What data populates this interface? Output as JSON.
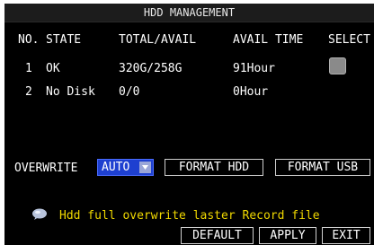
{
  "title": "HDD MANAGEMENT",
  "table": {
    "headers": {
      "no": "NO.",
      "state": "STATE",
      "total_avail": "TOTAL/AVAIL",
      "avail_time": "AVAIL TIME",
      "select": "SELECT"
    },
    "rows": [
      {
        "no": "1",
        "state": "OK",
        "total_avail": "320G/258G",
        "avail_time": "91Hour",
        "selected": false
      },
      {
        "no": "2",
        "state": "No Disk",
        "total_avail": "0/0",
        "avail_time": "0Hour"
      }
    ]
  },
  "overwrite": {
    "label": "OVERWRITE",
    "value": "AUTO"
  },
  "buttons": {
    "format_hdd": "FORMAT HDD",
    "format_usb": "FORMAT USB",
    "default": "DEFAULT",
    "apply": "APPLY",
    "exit": "EXIT"
  },
  "tip": {
    "icon": "speech-bubble-icon",
    "text": "Hdd full overwrite laster Record file"
  },
  "colors": {
    "background": "#000000",
    "title_bar": "#1c1c1c",
    "dropdown": "#1e40d0",
    "tip_text": "#f0d800",
    "checkbox": "#8a8a8a"
  }
}
